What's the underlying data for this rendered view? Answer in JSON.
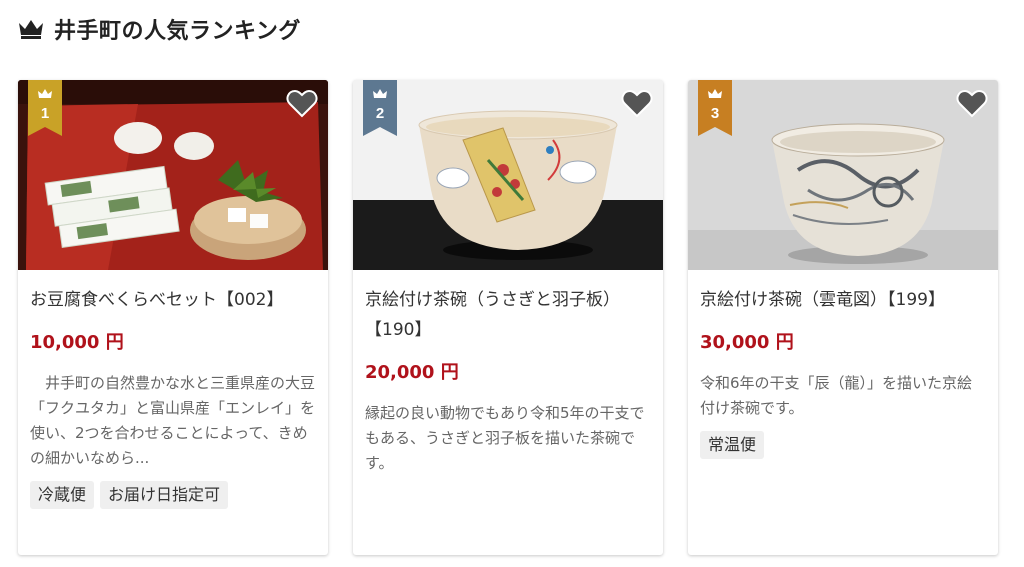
{
  "heading": {
    "title": "井手町の人気ランキング",
    "icon": "crown-icon"
  },
  "colors": {
    "gold": "#c9a227",
    "silver": "#5d7891",
    "bronze": "#c77f22",
    "price": "#b0121b",
    "heart": "#555555"
  },
  "cards": [
    {
      "rank": "1",
      "name": "お豆腐食べくらべセット【002】",
      "price": "10,000 円",
      "description": "　井手町の自然豊かな水と三重県産の大豆「フクユタカ」と富山県産「エンレイ」を使い、2つを合わせることによって、きめの細かいなめら...",
      "tags": [
        "冷蔵便",
        "お届け日指定可"
      ]
    },
    {
      "rank": "2",
      "name": "京絵付け茶碗（うさぎと羽子板）【190】",
      "price": "20,000 円",
      "description": "縁起の良い動物でもあり令和5年の干支でもある、うさぎと羽子板を描いた茶碗です。",
      "tags": []
    },
    {
      "rank": "3",
      "name": "京絵付け茶碗（雲竜図）【199】",
      "price": "30,000 円",
      "description": "令和6年の干支「辰（龍）」を描いた京絵付け茶碗です。",
      "tags": [
        "常温便"
      ]
    }
  ]
}
